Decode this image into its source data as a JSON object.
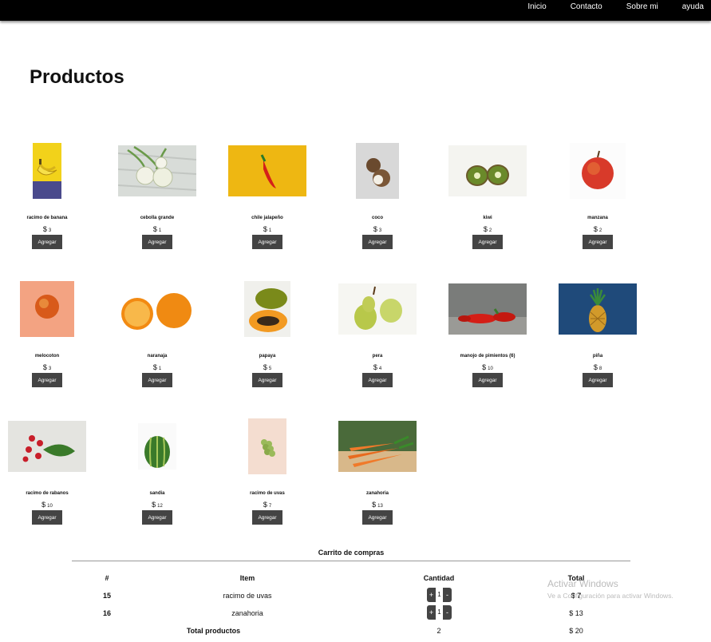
{
  "nav": [
    "Inicio",
    "Contacto",
    "Sobre mi",
    "ayuda"
  ],
  "page_title": "Productos",
  "currency": "$",
  "add_label": "Agregar",
  "products": [
    {
      "name": "racimo de banana",
      "price": "3",
      "icon": "banana"
    },
    {
      "name": "cebolla grande",
      "price": "1",
      "icon": "onion"
    },
    {
      "name": "chile jalapeño",
      "price": "1",
      "icon": "chili"
    },
    {
      "name": "coco",
      "price": "3",
      "icon": "coconut"
    },
    {
      "name": "kiwi",
      "price": "2",
      "icon": "kiwi"
    },
    {
      "name": "manzana",
      "price": "2",
      "icon": "apple"
    },
    {
      "name": "melocoton",
      "price": "3",
      "icon": "peach"
    },
    {
      "name": "naranaja",
      "price": "1",
      "icon": "orange"
    },
    {
      "name": "papaya",
      "price": "5",
      "icon": "papaya"
    },
    {
      "name": "pera",
      "price": "4",
      "icon": "pear"
    },
    {
      "name": "manojo de pimientos (6)",
      "price": "10",
      "icon": "peppers"
    },
    {
      "name": "piña",
      "price": "8",
      "icon": "pineapple"
    },
    {
      "name": "racimo de rabanos",
      "price": "10",
      "icon": "radish"
    },
    {
      "name": "sandia",
      "price": "12",
      "icon": "watermelon"
    },
    {
      "name": "racimo de uvas",
      "price": "7",
      "icon": "grapes"
    },
    {
      "name": "zanahoria",
      "price": "13",
      "icon": "carrot"
    }
  ],
  "cart": {
    "title": "Carrito de compras",
    "headers": [
      "#",
      "Item",
      "Cantidad",
      "Total"
    ],
    "rows": [
      {
        "id": "15",
        "item": "racimo de uvas",
        "qty": "1",
        "total": "$ 7"
      },
      {
        "id": "16",
        "item": "zanahoria",
        "qty": "1",
        "total": "$ 13"
      }
    ],
    "total_label": "Total productos",
    "total_qty": "2",
    "total_amount": "$ 20",
    "plus": "+",
    "minus": "-"
  },
  "watermark": {
    "line1": "Activar Windows",
    "line2": "Ve a Configuración para activar Windows."
  }
}
